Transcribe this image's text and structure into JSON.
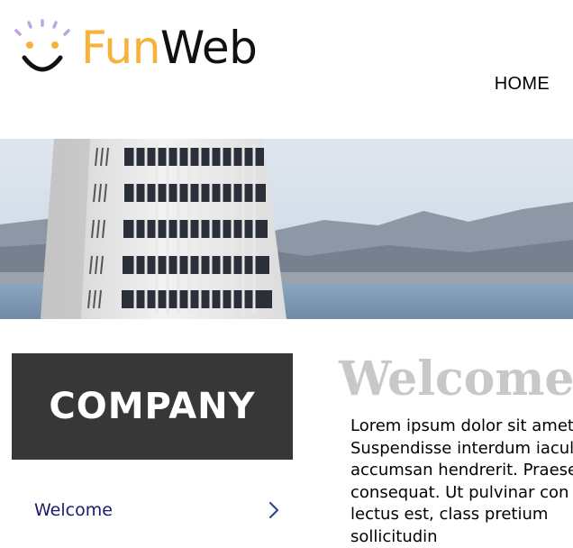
{
  "logo": {
    "text_fun": "Fun",
    "text_web": "Web",
    "colors": {
      "fun": "#f7b23b",
      "web": "#111111",
      "face": "#111111",
      "rays": "#b9a7e0"
    }
  },
  "nav": {
    "items": [
      {
        "label": "HOME"
      }
    ]
  },
  "banner": {
    "image": "city-tower-skyline-banner"
  },
  "sidebar": {
    "heading": "COMPANY",
    "heading_bg": "#373737",
    "links": [
      {
        "label": "Welcome",
        "icon": "chevron-right-icon"
      }
    ]
  },
  "main": {
    "title": "Welcome",
    "paragraph_lines": [
      "Lorem ipsum dolor sit amet,",
      "Suspendisse interdum iaculis",
      "accumsan hendrerit. Praesent",
      "consequat. Ut pulvinar con",
      "lectus est, class pretium",
      "sollicitudin"
    ]
  }
}
